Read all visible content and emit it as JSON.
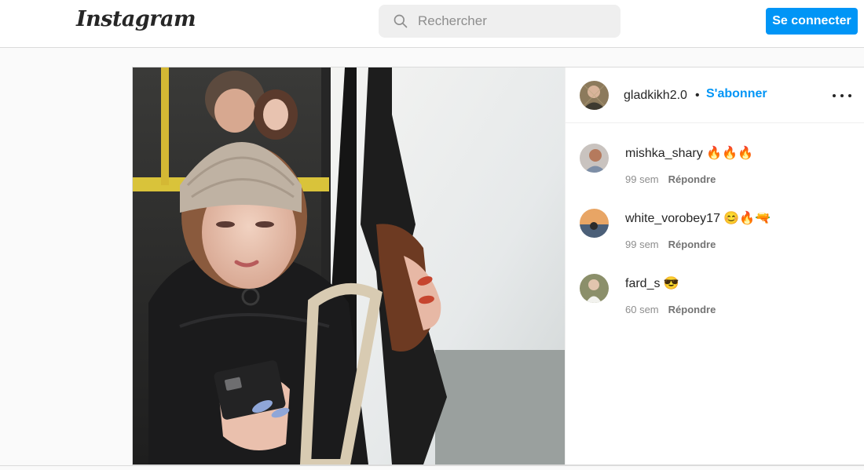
{
  "header": {
    "logo_text": "Instagram",
    "search_placeholder": "Rechercher",
    "login_label": "Se connecter"
  },
  "post": {
    "photo_icon": "post-photo",
    "author": "gladkikh2.0",
    "separator": "•",
    "follow_label": "S'abonner",
    "more_icon": "more-options-icon"
  },
  "comments": [
    {
      "user": "mishka_shary",
      "text": "🔥🔥🔥",
      "time": "99 sem",
      "reply": "Répondre"
    },
    {
      "user": "white_vorobey17",
      "text": "😊🔥🔫",
      "time": "99 sem",
      "reply": "Répondre"
    },
    {
      "user": "fard_s",
      "text": "😎",
      "time": "60 sem",
      "reply": "Répondre"
    }
  ],
  "colors": {
    "accent": "#0095f6",
    "text": "#262626",
    "muted": "#8e8e8e",
    "page_bg": "#fafafa",
    "border": "#dbdbdb"
  }
}
